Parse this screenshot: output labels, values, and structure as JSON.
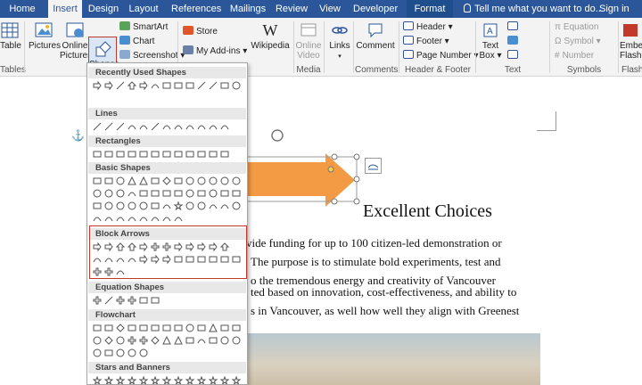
{
  "tabs": [
    {
      "label": "Home"
    },
    {
      "label": "Insert"
    },
    {
      "label": "Design"
    },
    {
      "label": "Layout"
    },
    {
      "label": "References"
    },
    {
      "label": "Mailings"
    },
    {
      "label": "Review"
    },
    {
      "label": "View"
    },
    {
      "label": "Developer"
    },
    {
      "label": "Format"
    }
  ],
  "tell_me": "Tell me what you want to do...",
  "sign_in": "Sign in",
  "ribbon": {
    "table": "Table",
    "pictures": "Pictures",
    "online_pictures_1": "Online",
    "online_pictures_2": "Pictures",
    "shapes": "Shapes",
    "smartart": "SmartArt",
    "chart": "Chart",
    "screenshot": "Screenshot",
    "store": "Store",
    "my_addins": "My Add-ins",
    "wikipedia": "Wikipedia",
    "online_video_1": "Online",
    "online_video_2": "Video",
    "links": "Links",
    "comment": "Comment",
    "header": "Header",
    "footer": "Footer",
    "page_number": "Page Number",
    "text_box_1": "Text",
    "text_box_2": "Box",
    "equation": "Equation",
    "symbol": "Symbol",
    "number": "Number",
    "embed_1": "Embed",
    "embed_2": "Flash",
    "groups": {
      "tables": "Tables",
      "media": "Media",
      "comments": "Comments",
      "header_footer": "Header & Footer",
      "text": "Text",
      "symbols": "Symbols",
      "flash": "Flash"
    }
  },
  "shapes_menu": {
    "categories": [
      "Recently Used Shapes",
      "Lines",
      "Rectangles",
      "Basic Shapes",
      "Block Arrows",
      "Equation Shapes",
      "Flowchart",
      "Stars and Banners"
    ]
  },
  "document": {
    "heading": "Excellent Choices",
    "lines": [
      "vide funding for up to 100 citizen-led demonstration or",
      "The purpose is to stimulate bold experiments, test and",
      "o the tremendous energy and creativity of Vancouver",
      "ted based on innovation, cost-effectiveness, and ability to",
      "s in Vancouver, as well how well they align with Greenest"
    ]
  },
  "colors": {
    "ribbon_blue": "#2b579a",
    "arrow_orange": "#f39a45",
    "highlight_red": "#c0392b"
  }
}
